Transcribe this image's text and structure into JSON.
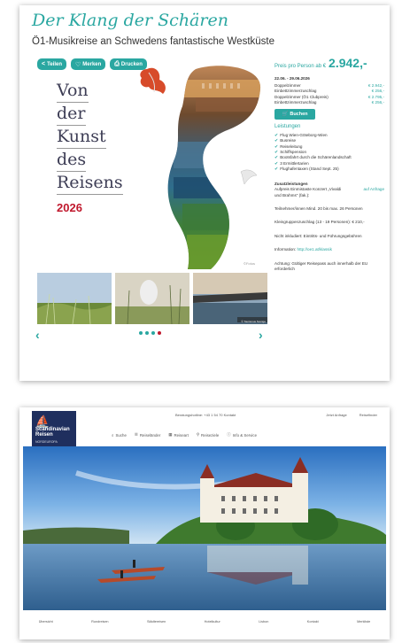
{
  "offer": {
    "title": "Der Klang der Schären",
    "subtitle": "Ö1-Musikreise an Schwedens fantastische Westküste",
    "share_buttons": [
      {
        "label": "Teilen",
        "icon": "share-icon"
      },
      {
        "label": "Merken",
        "icon": "heart-icon"
      },
      {
        "label": "Drucken",
        "icon": "print-icon"
      }
    ],
    "hero_lines": [
      "Von",
      "der",
      "Kunst",
      "des",
      "Reisens"
    ],
    "hero_year": "2026",
    "photo_credit": "©Fotos",
    "price_label": "Preis pro Person ab €",
    "price_value": "2.942,-",
    "dates": "22.06. - 29.06.2026",
    "rooms": [
      {
        "name": "Doppelzimmer",
        "price": "€ 2.942,-"
      },
      {
        "name": "Einbettzimmerzuschlag",
        "price": "€ 256,-"
      },
      {
        "name": "Doppelzimmer (Ö1 Clubpreis)",
        "price": "€ 2.795,-"
      },
      {
        "name": "Einbettzimmerzuschlag",
        "price": "€ 256,-"
      }
    ],
    "book_label": "Buchen",
    "services_heading": "Leistungen",
    "services": [
      "Flug Wien-Göteborg-Wien",
      "Busreise",
      "Reiseleitung",
      "Schiffspension",
      "Bootsfahrt durch die Schärenlandschaft",
      "3 Ermittlertarien",
      "Flughafentaxen (Stand Sept. 25)"
    ],
    "extras_heading": "Zusatzleistungen",
    "extras_text": "Aufpreis Einmistaste Konzert „Vivaldi und Brahms\" (fak.):",
    "extras_link": "auf Anfrage",
    "notes": [
      "Teilnehmer/innen Mind. 20 bis max. 26 Personen",
      "Kleingruppenzuschlag (13 - 19 Personen): € 210,-",
      "Nicht inkludiert: Eintritts- und Führungsgebühren"
    ],
    "info_prefix": "Information:",
    "info_link": "http://oe1.at/klassik",
    "warning": "Achtung: Gültiger Reisepass auch innerhalb der EU erforderlich",
    "thumb_credit": "© Tourismus Sverige",
    "prev_icon": "‹",
    "next_icon": "›"
  },
  "homepage": {
    "logo": {
      "mark": "⛵",
      "brand": "Scandinavian Reisen",
      "tag": "NORDEUROPA"
    },
    "topbar_text": "Beratungshotline: +43 1 54 70 Kontakt",
    "top_right": [
      "Jetzt Anfrage",
      "Reisefinder"
    ],
    "nav": [
      {
        "icon": "search-icon",
        "label": "Suche"
      },
      {
        "icon": "list-icon",
        "label": "Reiseländer"
      },
      {
        "icon": "grid-icon",
        "label": "Reiseart"
      },
      {
        "icon": "pin-icon",
        "label": "Reiseziele"
      },
      {
        "icon": "info-icon",
        "label": "Info & Service"
      }
    ],
    "footer": [
      "Übersicht",
      "Rundreisen",
      "Städtereisen",
      "Hotelkultur",
      "Lisbon",
      "Kontakt",
      "Merkliste"
    ]
  },
  "colors": {
    "teal": "#2aa7a1",
    "red": "#c0182d",
    "navy": "#1f2f5e"
  }
}
